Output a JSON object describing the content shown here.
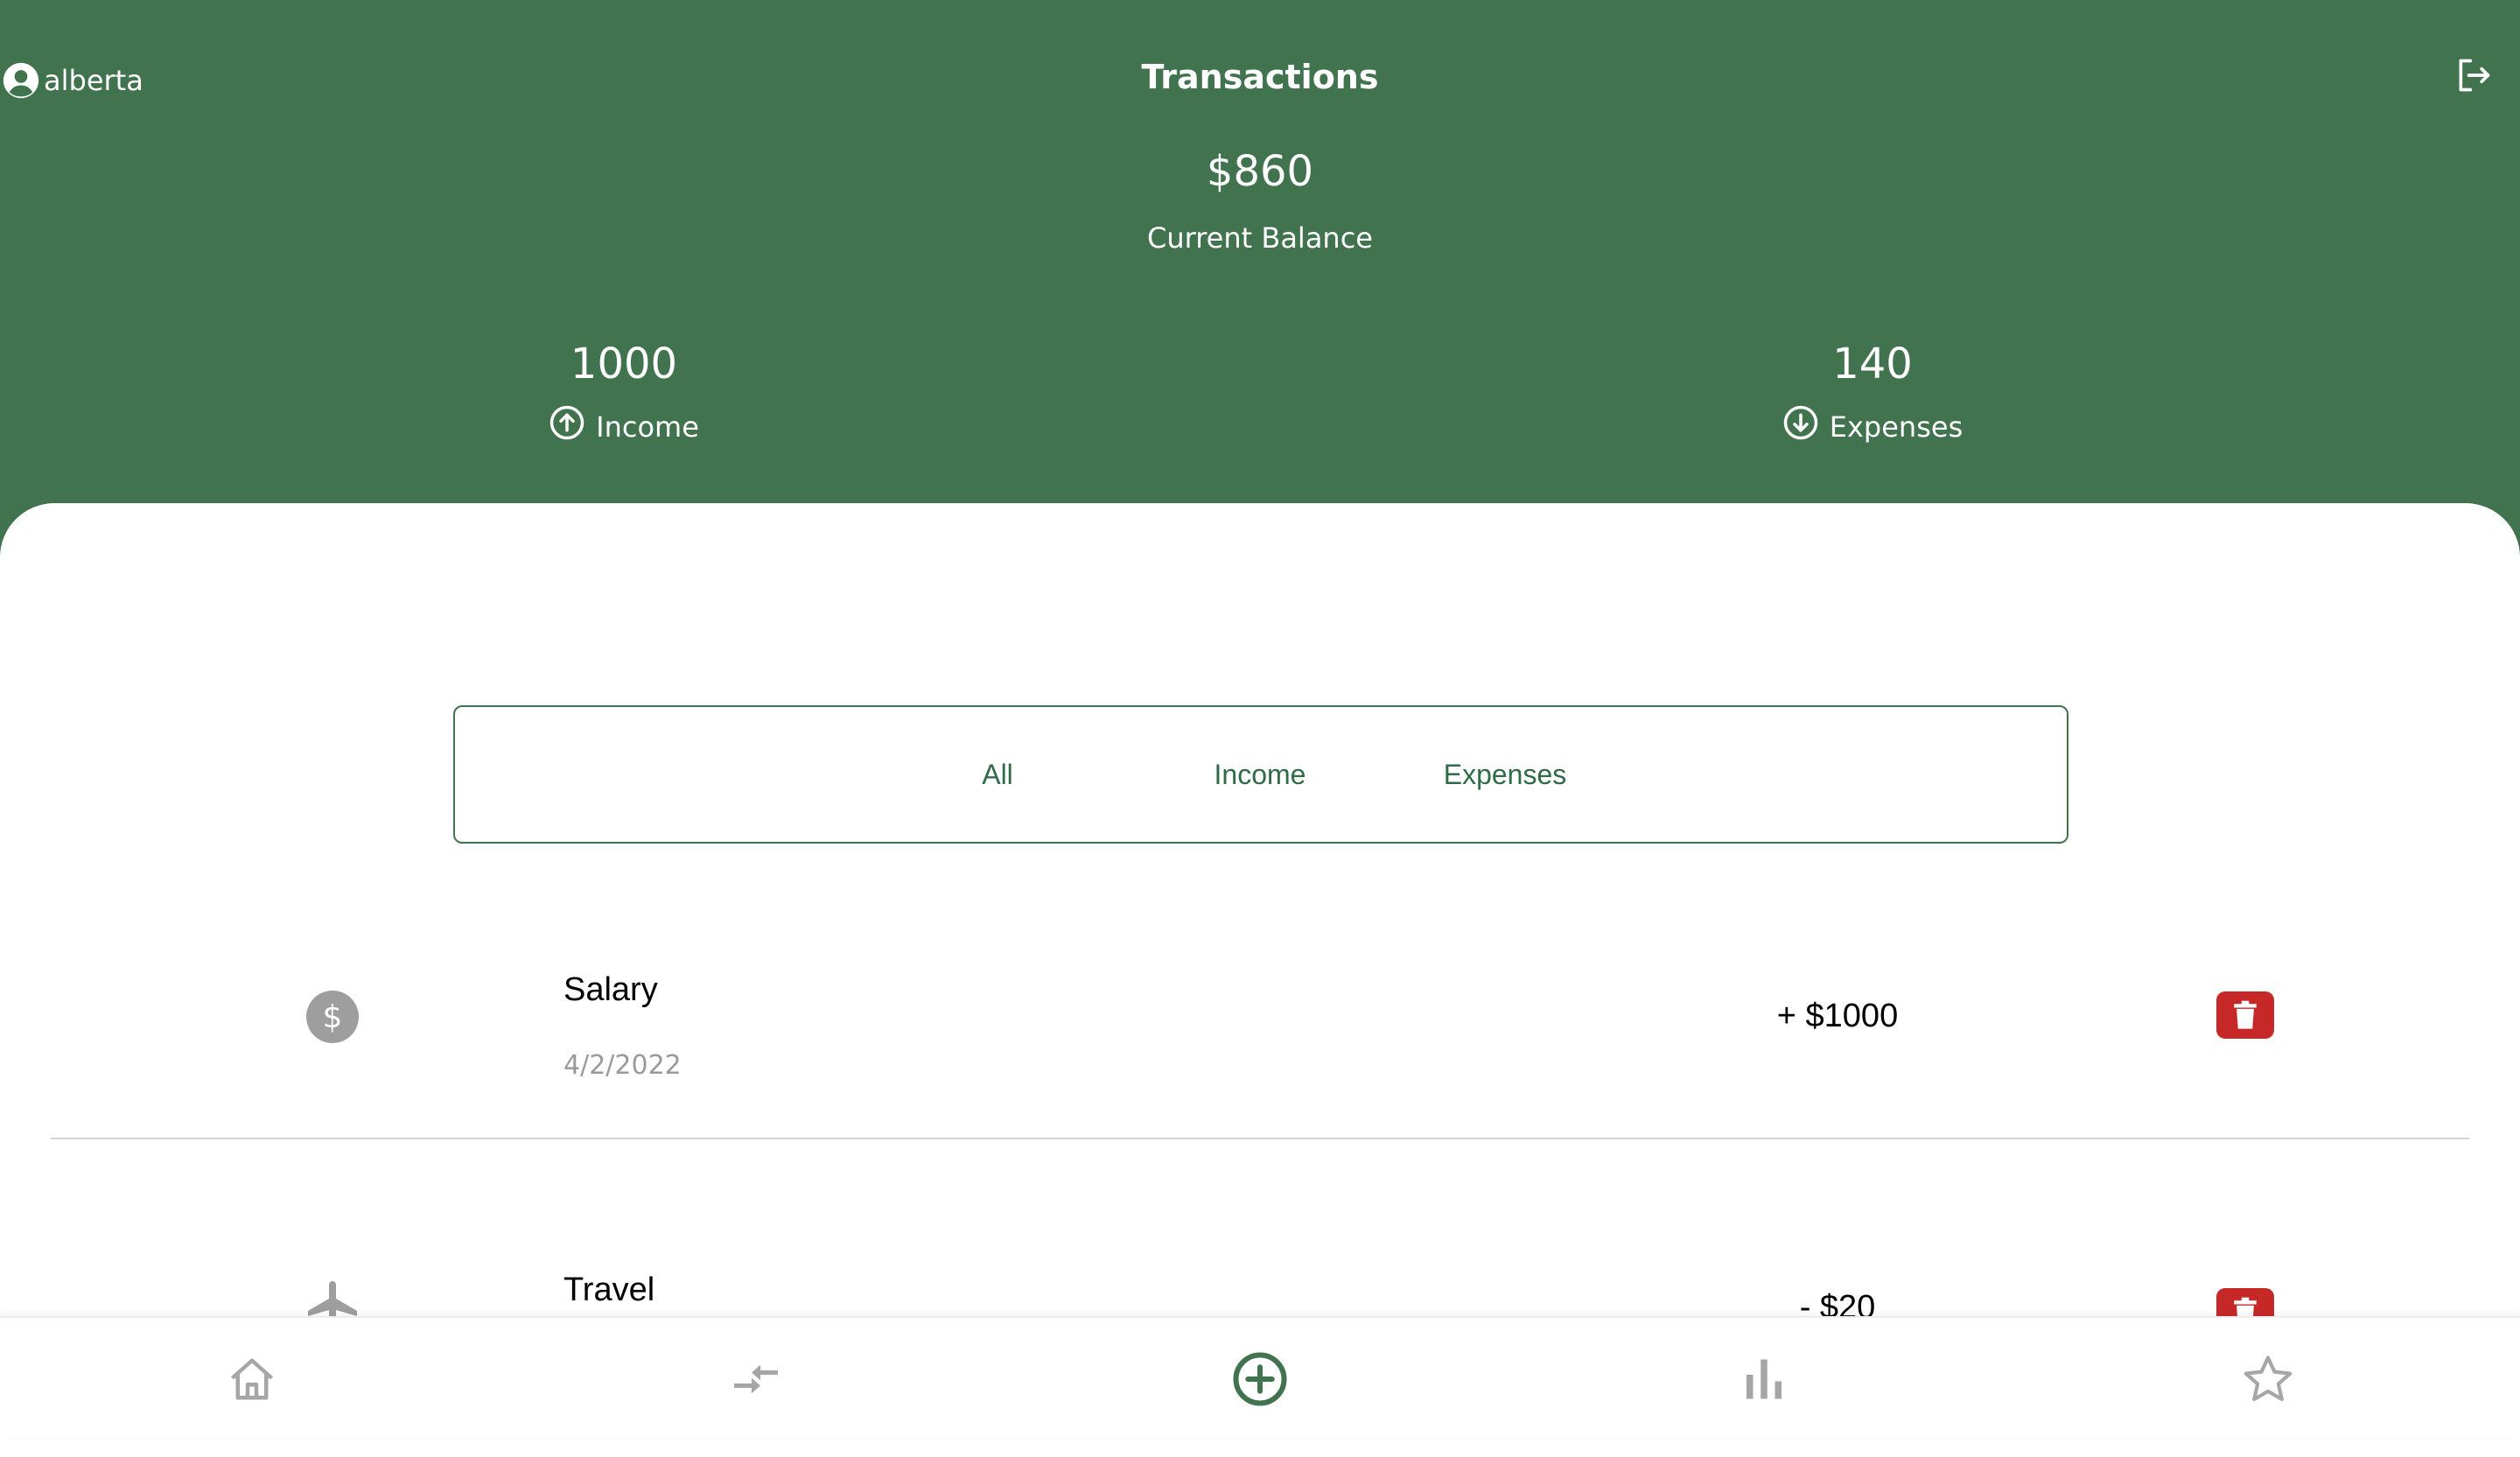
{
  "header": {
    "username": "alberta",
    "title": "Transactions",
    "balance": "$860",
    "balance_label": "Current Balance",
    "income_value": "1000",
    "income_label": "Income",
    "expenses_value": "140",
    "expenses_label": "Expenses",
    "icons": {
      "user": "user-circle-icon",
      "logout": "logout-icon",
      "income": "arrow-up-circle-icon",
      "expenses": "arrow-down-circle-icon"
    }
  },
  "filter": {
    "tabs": [
      "All",
      "Income",
      "Expenses"
    ]
  },
  "transactions": [
    {
      "name": "Salary",
      "date": "4/2/2022",
      "amount": "+ $1000",
      "icon": "dollar-icon"
    },
    {
      "name": "Travel",
      "date": "",
      "amount": "- $20",
      "icon": "airplane-icon"
    }
  ],
  "tabbar": {
    "items": [
      "home-icon",
      "transfers-icon",
      "add-circle-icon",
      "stats-icon",
      "star-icon"
    ],
    "active": "add-circle-icon"
  },
  "colors": {
    "primary": "#40734E",
    "danger": "#C62828",
    "muted": "#9a9a9a",
    "text": "#000000",
    "background": "#ffffff"
  }
}
